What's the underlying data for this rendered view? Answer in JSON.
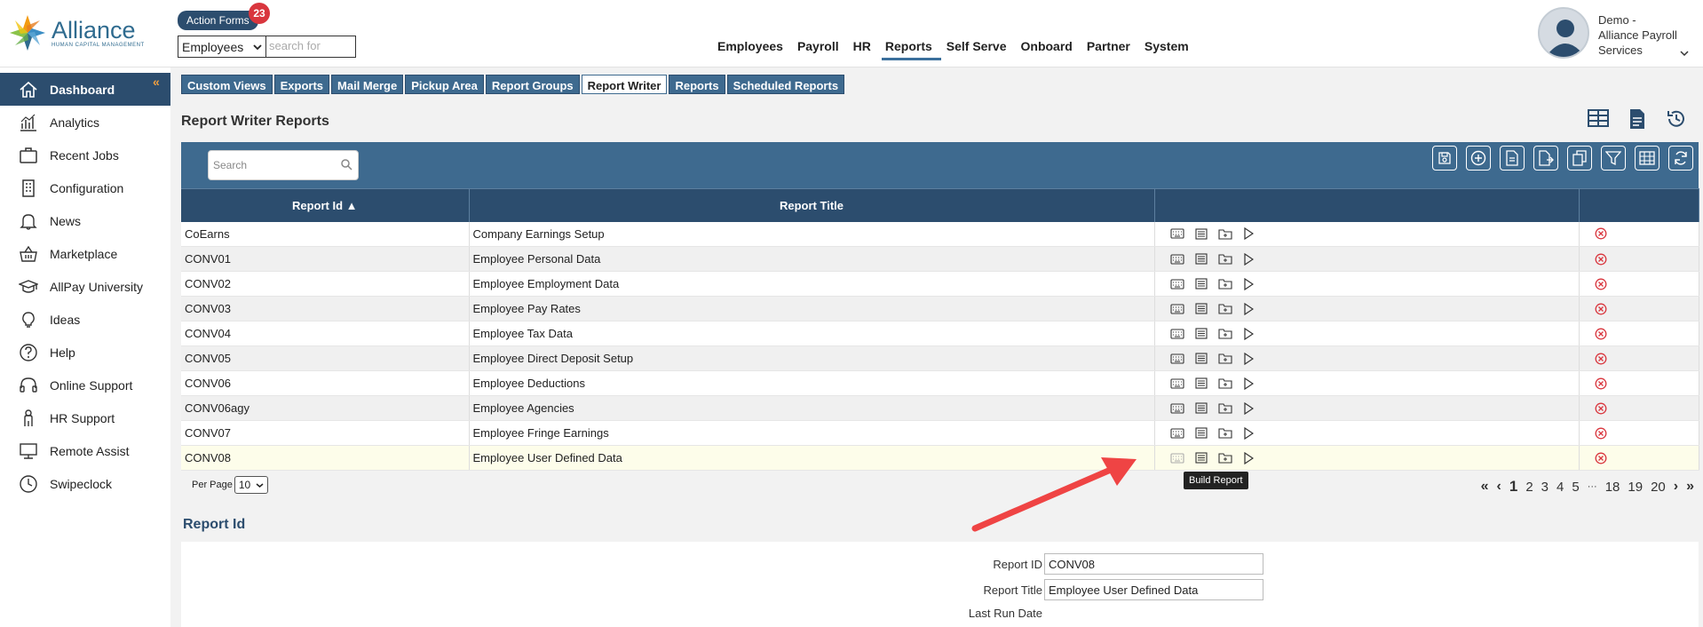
{
  "brand": {
    "name": "Alliance",
    "tagline": "HUMAN CAPITAL MANAGEMENT"
  },
  "header": {
    "action_forms_label": "Action Forms",
    "action_forms_count": "23",
    "scope_select_value": "Employees",
    "search_placeholder": "search for",
    "nav": [
      "Employees",
      "Payroll",
      "HR",
      "Reports",
      "Self Serve",
      "Onboard",
      "Partner",
      "System"
    ],
    "active_nav": "Reports",
    "user_line1": "Demo -",
    "user_line2": "Alliance Payroll",
    "user_line3": "Services"
  },
  "sidebar": {
    "items": [
      {
        "label": "Dashboard",
        "icon": "home-icon"
      },
      {
        "label": "Analytics",
        "icon": "analytics-icon"
      },
      {
        "label": "Recent Jobs",
        "icon": "briefcase-icon"
      },
      {
        "label": "Configuration",
        "icon": "building-icon"
      },
      {
        "label": "News",
        "icon": "bell-icon"
      },
      {
        "label": "Marketplace",
        "icon": "basket-icon"
      },
      {
        "label": "AllPay University",
        "icon": "graduation-cap-icon"
      },
      {
        "label": "Ideas",
        "icon": "lightbulb-icon"
      },
      {
        "label": "Help",
        "icon": "question-icon"
      },
      {
        "label": "Online Support",
        "icon": "headset-icon"
      },
      {
        "label": "HR Support",
        "icon": "person-icon"
      },
      {
        "label": "Remote Assist",
        "icon": "monitor-icon"
      },
      {
        "label": "Swipeclock",
        "icon": "clock-icon"
      }
    ],
    "active": "Dashboard"
  },
  "subtabs": {
    "items": [
      "Custom Views",
      "Exports",
      "Mail Merge",
      "Pickup Area",
      "Report Groups",
      "Report Writer",
      "Reports",
      "Scheduled Reports"
    ],
    "active": "Report Writer"
  },
  "page": {
    "title": "Report Writer Reports"
  },
  "grid": {
    "search_placeholder": "Search",
    "columns": {
      "id": "Report Id ▲",
      "title": "Report Title"
    },
    "rows": [
      {
        "id": "CoEarns",
        "title": "Company Earnings Setup"
      },
      {
        "id": "CONV01",
        "title": "Employee Personal Data"
      },
      {
        "id": "CONV02",
        "title": "Employee Employment Data"
      },
      {
        "id": "CONV03",
        "title": "Employee Pay Rates"
      },
      {
        "id": "CONV04",
        "title": "Employee Tax Data"
      },
      {
        "id": "CONV05",
        "title": "Employee Direct Deposit Setup"
      },
      {
        "id": "CONV06",
        "title": "Employee Deductions"
      },
      {
        "id": "CONV06agy",
        "title": "Employee Agencies"
      },
      {
        "id": "CONV07",
        "title": "Employee Fringe Earnings"
      },
      {
        "id": "CONV08",
        "title": "Employee User Defined Data"
      }
    ],
    "highlighted_row": 9,
    "tooltip": "Build Report",
    "per_page_label": "Per Page",
    "per_page_value": "10",
    "pager": {
      "pages_before": [
        "2",
        "3",
        "4",
        "5"
      ],
      "current": "1",
      "ellipsis": "···",
      "pages_after": [
        "18",
        "19",
        "20"
      ]
    }
  },
  "detail": {
    "title": "Report Id",
    "report_id_label": "Report ID",
    "report_id_value": "CONV08",
    "report_title_label": "Report Title",
    "report_title_value": "Employee User Defined Data",
    "last_run_label": "Last Run Date"
  },
  "colors": {
    "navy": "#2c4d6e",
    "toolbar": "#3e6a8f",
    "delete": "#d9363e",
    "arrow": "#ef4444"
  }
}
